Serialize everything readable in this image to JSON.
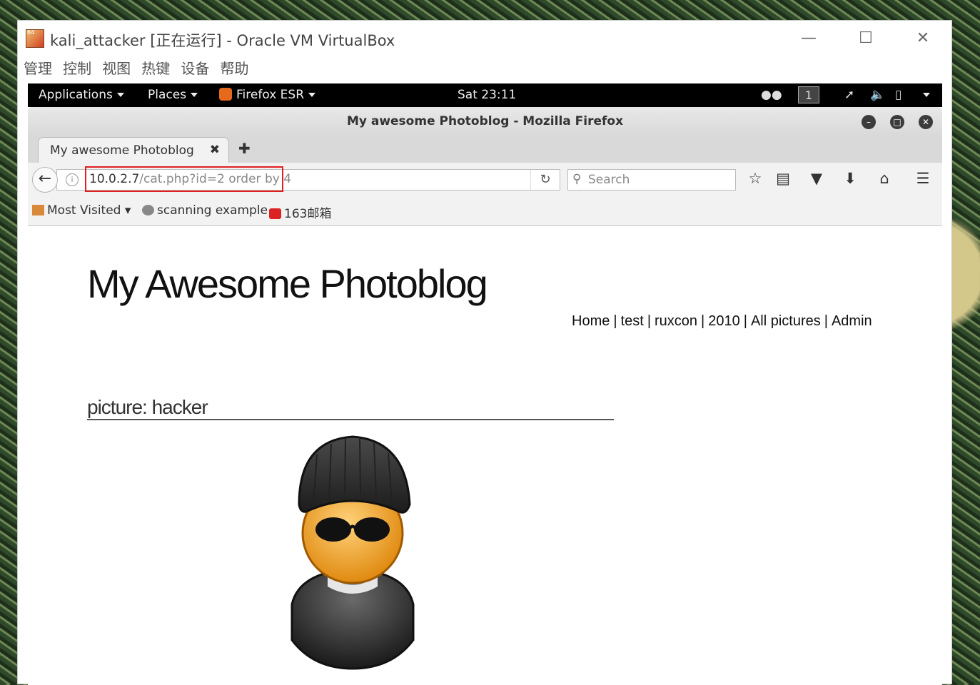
{
  "vbox": {
    "title": "kali_attacker [正在运行] - Oracle VM VirtualBox",
    "menu": [
      "管理",
      "控制",
      "视图",
      "热键",
      "设备",
      "帮助"
    ]
  },
  "gnome": {
    "applications": "Applications",
    "places": "Places",
    "firefox_app": "Firefox ESR",
    "clock": "Sat 23:11",
    "workspace": "1"
  },
  "firefox": {
    "window_title": "My awesome Photoblog - Mozilla Firefox",
    "tab_label": "My awesome Photoblog",
    "url_host": "10.0.2.7",
    "url_rest": "/cat.php?id=2 order by 4",
    "search_placeholder": "Search",
    "bookmarks": [
      "Most Visited ▾",
      "scanning example",
      "163邮箱"
    ]
  },
  "page": {
    "site_title": "My Awesome Photoblog",
    "nav": [
      "Home",
      "test",
      "ruxcon",
      "2010",
      "All pictures",
      "Admin"
    ],
    "picture_heading": "picture: hacker"
  },
  "colors": {
    "highlight_border": "#e02020",
    "gnome_bar": "#000000"
  }
}
